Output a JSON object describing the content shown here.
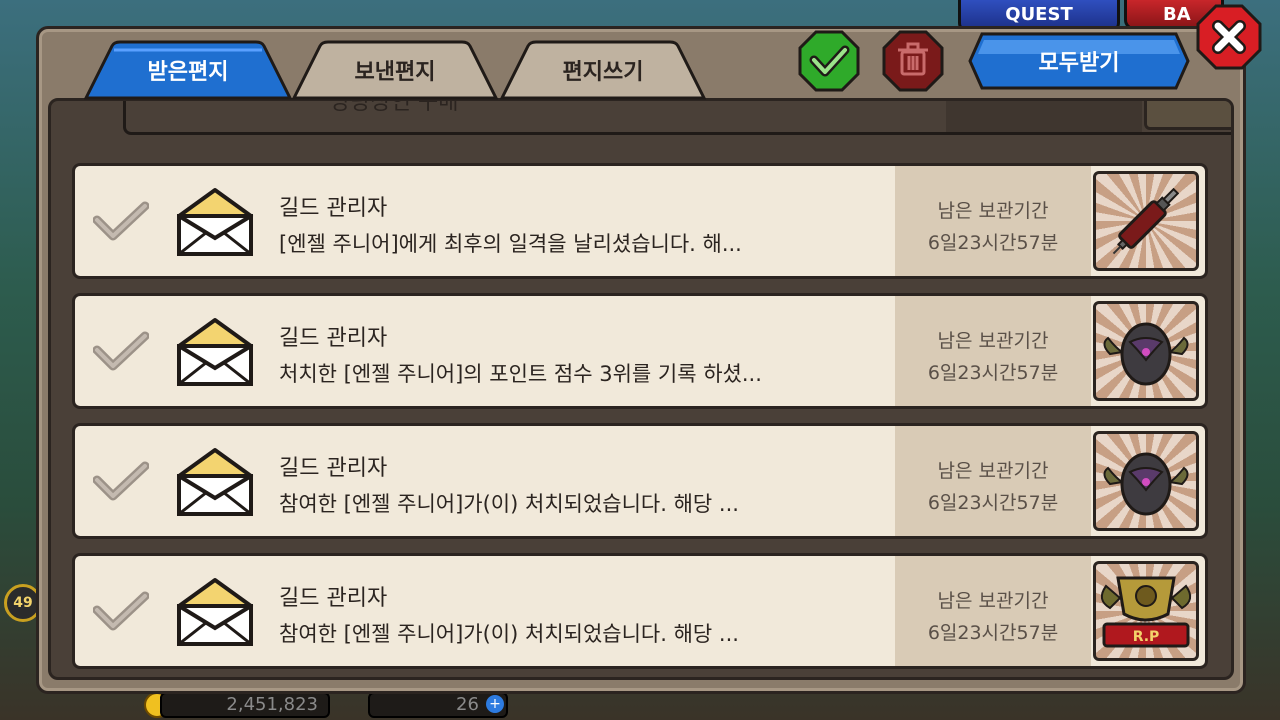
{
  "background": {
    "quest_label": "QUEST",
    "bag_label": "BA",
    "gold_amount": "2,451,823",
    "gem_amount": "26",
    "level": "49"
  },
  "tabs": [
    {
      "label": "받은편지",
      "active": true
    },
    {
      "label": "보낸편지",
      "active": false
    },
    {
      "label": "편지쓰기",
      "active": false
    }
  ],
  "actions": {
    "select_all_icon": "check-icon",
    "delete_icon": "trash-icon",
    "receive_all_label": "모두받기",
    "close_icon": "close-icon"
  },
  "partial_row": {
    "message": "방랑상인 구매"
  },
  "mails": [
    {
      "sender": "길드 관리자",
      "message": "[엔젤 주니어]에게 최후의 일격을 날리셨습니다. 해...",
      "expiry_label": "남은 보관기간",
      "expiry_time": "6일23시간57분",
      "reward_icon": "syringe-icon"
    },
    {
      "sender": "길드 관리자",
      "message": "처치한 [엔젤 주니어]의 포인트 점수 3위를 기록 하셨...",
      "expiry_label": "남은 보관기간",
      "expiry_time": "6일23시간57분",
      "reward_icon": "dark-egg-icon"
    },
    {
      "sender": "길드 관리자",
      "message": "참여한 [엔젤 주니어]가(이) 처치되었습니다. 해당 ...",
      "expiry_label": "남은 보관기간",
      "expiry_time": "6일23시간57분",
      "reward_icon": "dark-egg-icon"
    },
    {
      "sender": "길드 관리자",
      "message": "참여한 [엔젤 주니어]가(이) 처치되었습니다. 해당 ...",
      "expiry_label": "남은 보관기간",
      "expiry_time": "6일23시간57분",
      "reward_icon": "rp-trophy-icon"
    }
  ],
  "colors": {
    "active_tab": "#1f6fd0",
    "inactive_tab": "#bfb2a0",
    "check_button": "#2faa2a",
    "trash_button": "#7a1a1a",
    "receive_all_button": "#1f6fd0",
    "close_button": "#d81e24"
  }
}
